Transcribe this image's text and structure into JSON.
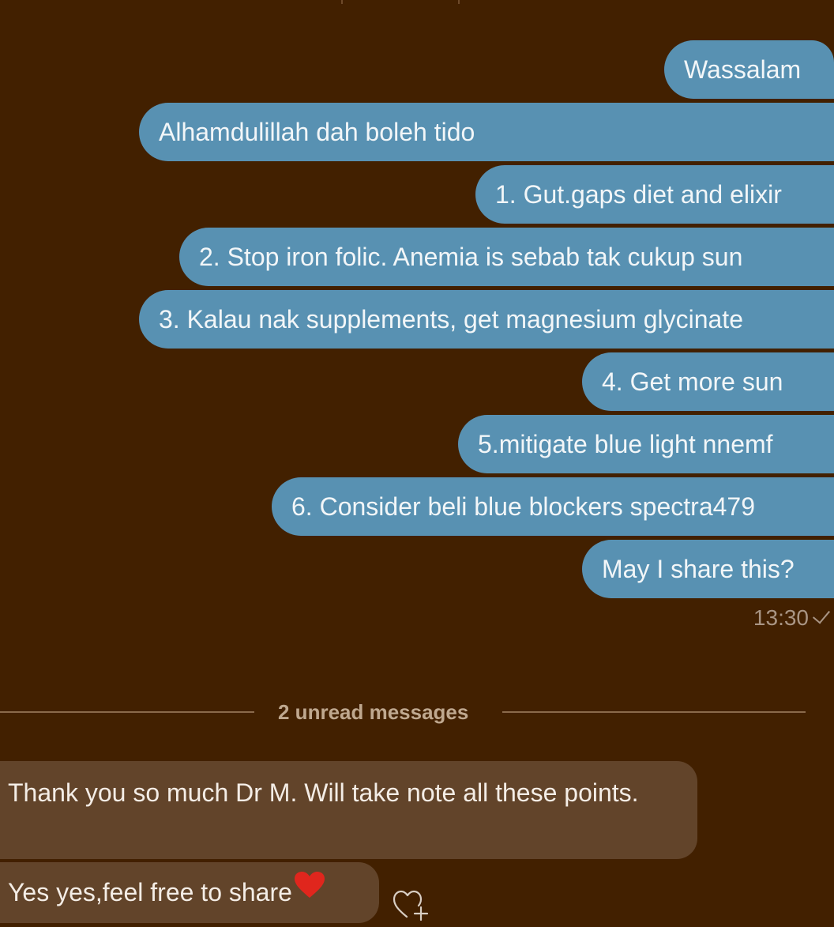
{
  "conversation": {
    "outgoing": [
      {
        "text": "Wassalam"
      },
      {
        "text": "Alhamdulillah dah boleh tido"
      },
      {
        "text": "1. Gut.gaps diet and elixir"
      },
      {
        "text": "2. Stop iron folic. Anemia is sebab tak cukup sun"
      },
      {
        "text": "3. Kalau nak supplements, get magnesium glycinate"
      },
      {
        "text": "4. Get more sun"
      },
      {
        "text": "5.mitigate blue light nnemf"
      },
      {
        "text": "6. Consider beli blue blockers spectra479"
      },
      {
        "text": "May I share this?"
      }
    ],
    "outgoing_time": "13:30",
    "outgoing_status_icon": "single-check-icon",
    "unread_divider": "2 unread messages",
    "incoming": [
      {
        "text": "Thank you so much Dr M. Will take note all these points."
      },
      {
        "text": "Yes yes,feel free to share",
        "emoji": "red-heart"
      }
    ],
    "reaction_button_icon": "heart-plus-icon"
  },
  "colors": {
    "background": "#422000",
    "outgoing_bubble": "#5891b2",
    "incoming_bubble": "#62442a",
    "heart": "#e0261d"
  }
}
